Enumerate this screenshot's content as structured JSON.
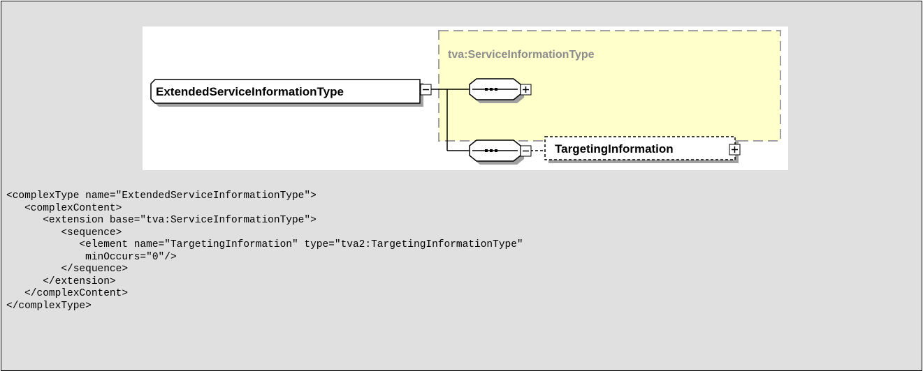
{
  "diagram": {
    "root_type": "ExtendedServiceInformationType",
    "base_type": "tva:ServiceInformationType",
    "child_element": "TargetingInformation",
    "colors": {
      "base_fill": "#ffffcc",
      "base_border": "#a0a0a0",
      "base_text": "#8c8c8c",
      "shadow": "#a0a0a0"
    }
  },
  "code_lines": [
    "<complexType name=\"ExtendedServiceInformationType\">",
    "   <complexContent>",
    "      <extension base=\"tva:ServiceInformationType\">",
    "         <sequence>",
    "            <element name=\"TargetingInformation\" type=\"tva2:TargetingInformationType\"",
    "             minOccurs=\"0\"/>",
    "         </sequence>",
    "      </extension>",
    "   </complexContent>",
    "</complexType>"
  ]
}
